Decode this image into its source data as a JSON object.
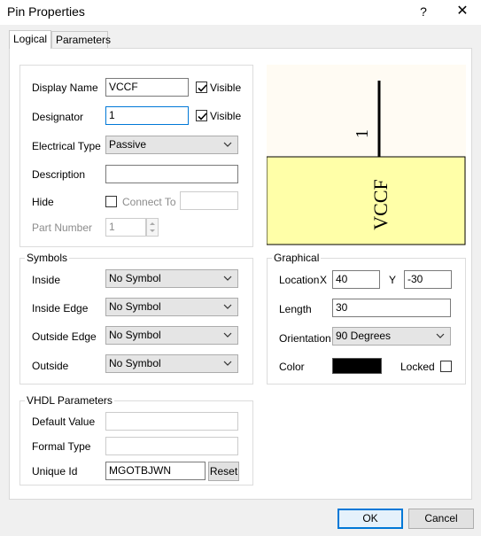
{
  "window": {
    "title": "Pin Properties",
    "help_label": "?",
    "close_label": "✕"
  },
  "tabs": [
    {
      "label": "Logical"
    },
    {
      "label": "Parameters"
    }
  ],
  "logical": {
    "display_name": {
      "label": "Display Name",
      "value": "VCCF",
      "visible_label": "Visible",
      "visible_checked": true
    },
    "designator": {
      "label": "Designator",
      "value": "1",
      "visible_label": "Visible",
      "visible_checked": true
    },
    "electrical_type": {
      "label": "Electrical Type",
      "value": "Passive"
    },
    "description": {
      "label": "Description",
      "value": ""
    },
    "hide": {
      "label": "Hide",
      "checked": false,
      "connect_to_label": "Connect To",
      "connect_to_value": ""
    },
    "part_number": {
      "label": "Part Number",
      "value": "1"
    }
  },
  "preview": {
    "pin_name": "VCCF",
    "pin_designator": "1",
    "pin_color": "#000000",
    "body_color": "#ffffa8",
    "body_border": "#000000",
    "background": "#fffbf3"
  },
  "symbols": {
    "title": "Symbols",
    "inside": {
      "label": "Inside",
      "value": "No Symbol"
    },
    "inside_edge": {
      "label": "Inside Edge",
      "value": "No Symbol"
    },
    "outside_edge": {
      "label": "Outside Edge",
      "value": "No Symbol"
    },
    "outside": {
      "label": "Outside",
      "value": "No Symbol"
    }
  },
  "graphical": {
    "title": "Graphical",
    "location_label": "Location",
    "x_label": "X",
    "x_value": "40",
    "y_label": "Y",
    "y_value": "-30",
    "length_label": "Length",
    "length_value": "30",
    "orientation_label": "Orientation",
    "orientation_value": "90 Degrees",
    "color_label": "Color",
    "color_value": "#000000",
    "locked_label": "Locked",
    "locked_checked": false
  },
  "vhdl": {
    "title": "VHDL Parameters",
    "default_value": {
      "label": "Default Value",
      "value": ""
    },
    "formal_type": {
      "label": "Formal Type",
      "value": ""
    },
    "unique_id": {
      "label": "Unique Id",
      "value": "MGOTBJWN"
    },
    "reset_label": "Reset"
  },
  "footer": {
    "ok_label": "OK",
    "cancel_label": "Cancel"
  }
}
